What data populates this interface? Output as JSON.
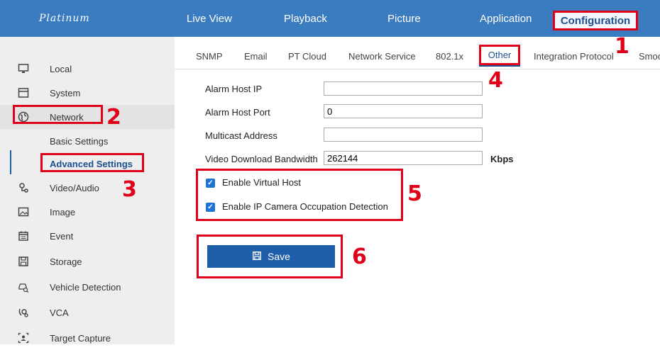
{
  "app": {
    "logo": "Platinum"
  },
  "nav": {
    "live_view": "Live View",
    "playback": "Playback",
    "picture": "Picture",
    "application": "Application",
    "configuration": "Configuration"
  },
  "sidebar": {
    "local": "Local",
    "system": "System",
    "network": "Network",
    "basic_settings": "Basic Settings",
    "advanced_settings": "Advanced Settings",
    "video_audio": "Video/Audio",
    "image": "Image",
    "event": "Event",
    "storage": "Storage",
    "vehicle_detection": "Vehicle Detection",
    "vca": "VCA",
    "target_capture": "Target Capture"
  },
  "tabs": {
    "snmp": "SNMP",
    "email": "Email",
    "pt_cloud": "PT Cloud",
    "network_service": "Network Service",
    "dot1x": "802.1x",
    "other": "Other",
    "integration_protocol": "Integration Protocol",
    "smoo": "Smoo"
  },
  "form": {
    "alarm_host_ip_label": "Alarm Host IP",
    "alarm_host_ip_value": "",
    "alarm_host_port_label": "Alarm Host Port",
    "alarm_host_port_value": "0",
    "multicast_address_label": "Multicast Address",
    "multicast_address_value": "",
    "video_download_bandwidth_label": "Video Download Bandwidth",
    "video_download_bandwidth_value": "262144",
    "bandwidth_unit": "Kbps",
    "enable_virtual_host_label": "Enable Virtual Host",
    "enable_virtual_host_checked": true,
    "enable_ip_camera_occupation_label": "Enable IP Camera Occupation Detection",
    "enable_ip_camera_occupation_checked": true,
    "save_label": "Save"
  },
  "steps": {
    "s1": "1",
    "s2": "2",
    "s3": "3",
    "s4": "4",
    "s5": "5",
    "s6": "6"
  },
  "colors": {
    "header": "#3b7bbf",
    "annotation": "#e10019",
    "primary": "#1f5ea8"
  }
}
